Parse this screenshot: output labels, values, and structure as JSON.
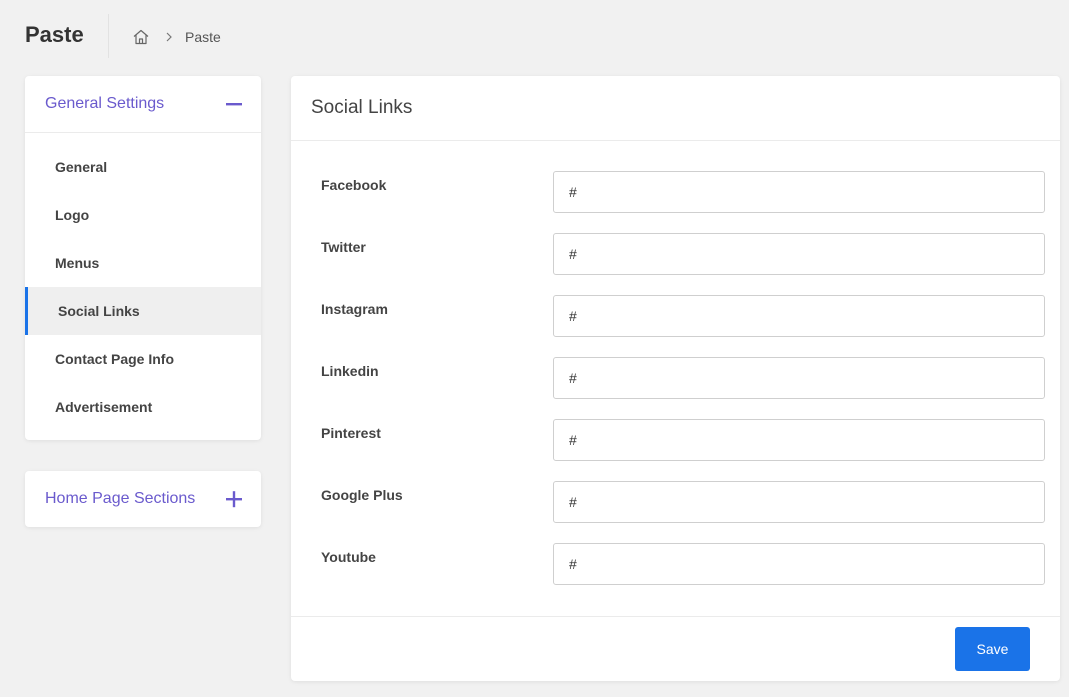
{
  "header": {
    "title": "Paste",
    "breadcrumb": {
      "home_icon": "home-icon",
      "separator_icon": "chevron-right-icon",
      "current": "Paste"
    }
  },
  "sidebar": {
    "general_settings": {
      "title": "General Settings",
      "toggle_icon": "minus-icon",
      "accent_color": "#6a5acd",
      "items": [
        {
          "label": "General",
          "active": false
        },
        {
          "label": "Logo",
          "active": false
        },
        {
          "label": "Menus",
          "active": false
        },
        {
          "label": "Social Links",
          "active": true
        },
        {
          "label": "Contact Page Info",
          "active": false
        },
        {
          "label": "Advertisement",
          "active": false
        }
      ]
    },
    "home_page_sections": {
      "title": "Home Page Sections",
      "toggle_icon": "plus-icon"
    }
  },
  "main": {
    "title": "Social Links",
    "fields": [
      {
        "label": "Facebook",
        "value": "#"
      },
      {
        "label": "Twitter",
        "value": "#"
      },
      {
        "label": "Instagram",
        "value": "#"
      },
      {
        "label": "Linkedin",
        "value": "#"
      },
      {
        "label": "Pinterest",
        "value": "#"
      },
      {
        "label": "Google Plus",
        "value": "#"
      },
      {
        "label": "Youtube",
        "value": "#"
      }
    ],
    "save_label": "Save",
    "save_color": "#1a73e8"
  }
}
